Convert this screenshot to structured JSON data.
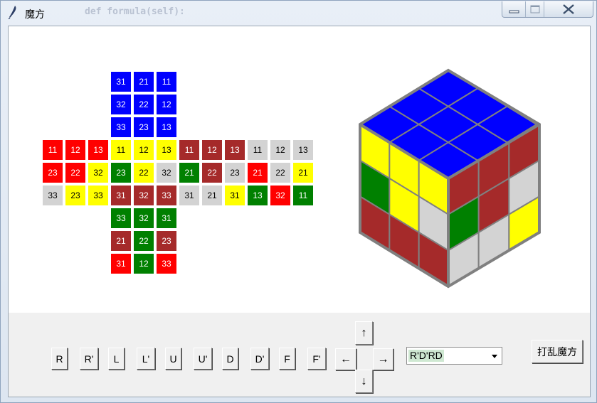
{
  "window": {
    "title": "魔方",
    "background_code_text": "def formula(self):"
  },
  "colors": {
    "red": "#ff0000",
    "maroon": "#a52a2a",
    "gray": "#d3d3d3",
    "yellow": "#ffff00",
    "green": "#008000",
    "blue": "#0000ff",
    "white": "#ffffff",
    "black": "#000000",
    "cube_edge": "#808080",
    "panel": "#f0f0f0",
    "combo_highlight": "#cfe8d2"
  },
  "net": {
    "top": [
      [
        {
          "t": "31",
          "c": "blue"
        },
        {
          "t": "21",
          "c": "blue"
        },
        {
          "t": "11",
          "c": "blue"
        }
      ],
      [
        {
          "t": "32",
          "c": "blue"
        },
        {
          "t": "22",
          "c": "blue"
        },
        {
          "t": "12",
          "c": "blue"
        }
      ],
      [
        {
          "t": "33",
          "c": "blue"
        },
        {
          "t": "23",
          "c": "blue"
        },
        {
          "t": "13",
          "c": "blue"
        }
      ]
    ],
    "left": [
      [
        {
          "t": "11",
          "c": "red"
        },
        {
          "t": "12",
          "c": "red"
        },
        {
          "t": "13",
          "c": "red"
        }
      ],
      [
        {
          "t": "23",
          "c": "red"
        },
        {
          "t": "22",
          "c": "red"
        },
        {
          "t": "32",
          "c": "yellow"
        }
      ],
      [
        {
          "t": "33",
          "c": "gray"
        },
        {
          "t": "23",
          "c": "yellow"
        },
        {
          "t": "33",
          "c": "yellow"
        }
      ]
    ],
    "front": [
      [
        {
          "t": "11",
          "c": "yellow"
        },
        {
          "t": "12",
          "c": "yellow"
        },
        {
          "t": "13",
          "c": "yellow"
        }
      ],
      [
        {
          "t": "23",
          "c": "green"
        },
        {
          "t": "22",
          "c": "yellow"
        },
        {
          "t": "32",
          "c": "gray"
        }
      ],
      [
        {
          "t": "31",
          "c": "maroon"
        },
        {
          "t": "32",
          "c": "maroon"
        },
        {
          "t": "33",
          "c": "maroon"
        }
      ]
    ],
    "right": [
      [
        {
          "t": "11",
          "c": "maroon"
        },
        {
          "t": "12",
          "c": "maroon"
        },
        {
          "t": "13",
          "c": "maroon"
        }
      ],
      [
        {
          "t": "21",
          "c": "green"
        },
        {
          "t": "22",
          "c": "maroon"
        },
        {
          "t": "23",
          "c": "gray"
        }
      ],
      [
        {
          "t": "31",
          "c": "gray"
        },
        {
          "t": "21",
          "c": "gray"
        },
        {
          "t": "31",
          "c": "yellow"
        }
      ]
    ],
    "back": [
      [
        {
          "t": "11",
          "c": "gray"
        },
        {
          "t": "12",
          "c": "gray"
        },
        {
          "t": "13",
          "c": "gray"
        }
      ],
      [
        {
          "t": "21",
          "c": "red"
        },
        {
          "t": "22",
          "c": "gray"
        },
        {
          "t": "21",
          "c": "yellow"
        }
      ],
      [
        {
          "t": "13",
          "c": "green"
        },
        {
          "t": "32",
          "c": "red"
        },
        {
          "t": "11",
          "c": "green"
        }
      ]
    ],
    "bottom": [
      [
        {
          "t": "33",
          "c": "green"
        },
        {
          "t": "32",
          "c": "green"
        },
        {
          "t": "31",
          "c": "green"
        }
      ],
      [
        {
          "t": "21",
          "c": "maroon"
        },
        {
          "t": "22",
          "c": "green"
        },
        {
          "t": "23",
          "c": "maroon"
        }
      ],
      [
        {
          "t": "31",
          "c": "red"
        },
        {
          "t": "12",
          "c": "green"
        },
        {
          "t": "33",
          "c": "red"
        }
      ]
    ]
  },
  "cube3d": {
    "top": [
      [
        "blue",
        "blue",
        "blue"
      ],
      [
        "blue",
        "blue",
        "blue"
      ],
      [
        "blue",
        "blue",
        "blue"
      ]
    ],
    "front": [
      [
        "yellow",
        "yellow",
        "yellow"
      ],
      [
        "green",
        "yellow",
        "gray"
      ],
      [
        "maroon",
        "maroon",
        "maroon"
      ]
    ],
    "right": [
      [
        "maroon",
        "maroon",
        "maroon"
      ],
      [
        "green",
        "maroon",
        "gray"
      ],
      [
        "gray",
        "gray",
        "yellow"
      ]
    ]
  },
  "controls": {
    "moves": [
      "R",
      "R'",
      "L",
      "L'",
      "U",
      "U'",
      "D",
      "D'",
      "F",
      "F'"
    ],
    "arrows": {
      "up": "↑",
      "left": "←",
      "right": "→",
      "down": "↓"
    },
    "formula_value": "R'D'RD",
    "scramble_label": "打乱魔方"
  }
}
